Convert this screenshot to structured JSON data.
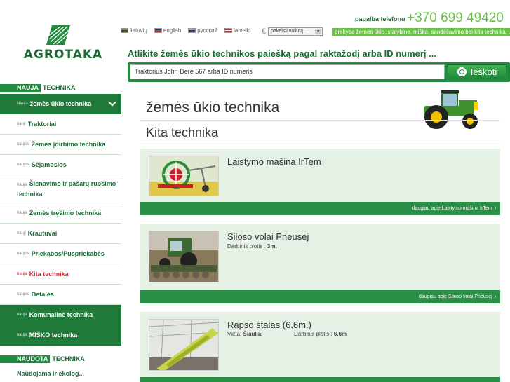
{
  "brand": {
    "name": "AGROTAKA"
  },
  "languages": [
    {
      "label": "lietuvių",
      "flag": "lt"
    },
    {
      "label": "english",
      "flag": "en"
    },
    {
      "label": "русский",
      "flag": "ru"
    },
    {
      "label": "latviski",
      "flag": "lv"
    }
  ],
  "currency": {
    "symbol": "€",
    "select_value": "pakeisti valiutą..."
  },
  "contact": {
    "label": "pagalba telefonu",
    "phone": "+370 699 49420"
  },
  "marquee": "prekyba žemės ūkio, statybine, miško, sandėliavimo bei kita technika, ...",
  "search": {
    "title": "Atlikite žemės ūkio technikos paiešką pagal raktažodį arba ID numerį ...",
    "value": "Traktorius John Dere 567 arba ID numeris",
    "button_label": "Ieškoti"
  },
  "sidebar": {
    "new_section": {
      "tag": "NAUJA",
      "rest": "TECHNIKA"
    },
    "items": [
      {
        "pre": "Nauja",
        "label": "žemės ūkio technika"
      },
      {
        "pre": "nauji",
        "label": "Traktoriai"
      },
      {
        "pre": "naujos",
        "label": "Žemės įdirbimo technika"
      },
      {
        "pre": "naujos",
        "label": "Sėjamosios"
      },
      {
        "pre": "nauja",
        "label": "Šienavimo ir pašarų ruošimo technika"
      },
      {
        "pre": "nauja",
        "label": "Žemės tręšimo technika"
      },
      {
        "pre": "nauji",
        "label": "Krautuvai"
      },
      {
        "pre": "naujos",
        "label": "Priekabos/Puspriekabės"
      },
      {
        "pre": "nauja",
        "label": "Kita technika"
      },
      {
        "pre": "naujos",
        "label": "Detalės"
      },
      {
        "pre": "nauja",
        "label": "Komunalinė technika"
      },
      {
        "pre": "nauja",
        "label": "MIŠKO technika"
      }
    ],
    "used_section": {
      "tag": "NAUDOTA",
      "rest": "TECHNIKA"
    },
    "used_first": "Naudojama ir ekolog..."
  },
  "main": {
    "category_title": "žemės ūkio technika",
    "sub_title": "Kita technika",
    "products": [
      {
        "name": "Laistymo mašina IrTem",
        "more": "daugiau apie Laistymo mašina IrTem"
      },
      {
        "name": "Siloso volai Pneusej",
        "meta_label": "Darbinis plotis :",
        "meta_value": "3m.",
        "more": "daugiau apie Siloso volai Pneusej"
      },
      {
        "name": "Rapso stalas (6,6m.)",
        "loc_label": "Vieta:",
        "loc_value": "Šiauliai",
        "meta_label": "Darbinis plotis :",
        "meta_value": "6,6m"
      }
    ]
  },
  "colors": {
    "accent": "#1f8c3e",
    "light_green": "#6cc04a",
    "highlight": "#d9262c"
  }
}
